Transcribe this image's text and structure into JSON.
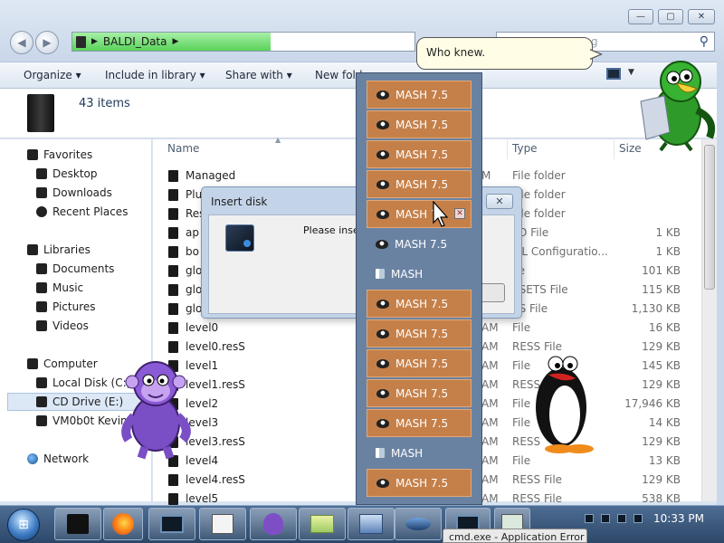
{
  "window": {
    "title_buttons": [
      "—",
      "▢",
      "✕"
    ],
    "address": {
      "folder": "BALDI_Data",
      "progress_percent": 58
    },
    "search_placeholder": "g",
    "toolbar": {
      "organize": "Organize ▾",
      "include": "Include in library ▾",
      "share": "Share with ▾",
      "new_folder": "New fold"
    },
    "item_count": "43 items"
  },
  "sidebar": {
    "favorites": "Favorites",
    "desktop": "Desktop",
    "downloads": "Downloads",
    "recent": "Recent Places",
    "libraries": "Libraries",
    "documents": "Documents",
    "music": "Music",
    "pictures": "Pictures",
    "videos": "Videos",
    "computer": "Computer",
    "local_disk": "Local Disk (C:)",
    "cd_drive": "CD Drive (E:)",
    "vm": "VM0b0t Kevin",
    "network": "Network"
  },
  "columns": {
    "name": "Name",
    "type": "Type",
    "size": "Size"
  },
  "files": [
    {
      "name": "Managed",
      "mod": "M",
      "type": "File folder",
      "size": ""
    },
    {
      "name": "Plu",
      "mod": "M",
      "type": "File folder",
      "size": ""
    },
    {
      "name": "Res",
      "mod": "M",
      "type": "File folder",
      "size": ""
    },
    {
      "name": "ap",
      "mod": "",
      "type": "FO File",
      "size": "1 KB"
    },
    {
      "name": "bo",
      "mod": "",
      "type": "ML Configuratio...",
      "size": "1 KB"
    },
    {
      "name": "glo",
      "mod": "",
      "type": "ile",
      "size": "101 KB"
    },
    {
      "name": "glo",
      "mod": "",
      "type": "SSETS File",
      "size": "115 KB"
    },
    {
      "name": "glo",
      "mod": "",
      "type": "SS File",
      "size": "1,130 KB"
    },
    {
      "name": "level0",
      "mod": "AM",
      "type": "File",
      "size": "16 KB"
    },
    {
      "name": "level0.resS",
      "mod": "AM",
      "type": "RESS File",
      "size": "129 KB"
    },
    {
      "name": "level1",
      "mod": "AM",
      "type": "File",
      "size": "145 KB"
    },
    {
      "name": "level1.resS",
      "mod": "AM",
      "type": "RESS",
      "size": "129 KB"
    },
    {
      "name": "level2",
      "mod": "AM",
      "type": "File",
      "size": "17,946 KB"
    },
    {
      "name": "level3",
      "mod": "AM",
      "type": "File",
      "size": "14 KB"
    },
    {
      "name": "level3.resS",
      "mod": "AM",
      "type": "RESS",
      "size": "129 KB"
    },
    {
      "name": "level4",
      "mod": "AM",
      "type": "File",
      "size": "13 KB"
    },
    {
      "name": "level4.resS",
      "mod": "AM",
      "type": "RESS File",
      "size": "129 KB"
    },
    {
      "name": "level5",
      "mod": "AM",
      "type": "RESS File",
      "size": "538 KB"
    }
  ],
  "dialog": {
    "title": "Insert disk",
    "message": "Please inser",
    "close": "✕"
  },
  "mash_menu": [
    {
      "label": "MASH 7.5",
      "style": "orange"
    },
    {
      "label": "MASH 7.5",
      "style": "orange"
    },
    {
      "label": "MASH 7.5",
      "style": "orange"
    },
    {
      "label": "MASH 7.5",
      "style": "orange"
    },
    {
      "label": "MASH 7.",
      "style": "orange",
      "close": "✕"
    },
    {
      "label": "MASH 7.5",
      "style": "plain"
    },
    {
      "label": "MASH",
      "style": "plain-doc"
    },
    {
      "label": "MASH 7.5",
      "style": "orange"
    },
    {
      "label": "MASH 7.5",
      "style": "orange"
    },
    {
      "label": "MASH 7.5",
      "style": "orange"
    },
    {
      "label": "MASH 7.5",
      "style": "orange"
    },
    {
      "label": "MASH 7.5",
      "style": "orange"
    },
    {
      "label": "MASH",
      "style": "plain-doc"
    },
    {
      "label": "MASH 7.5",
      "style": "orange"
    }
  ],
  "bubble": "Who knew.",
  "taskbar": {
    "clock": "10:33 PM",
    "cmd_tab": "cmd.exe - Application Error"
  },
  "colors": {
    "mash_orange": "#c5804a",
    "mash_menu_bg": "#6a82a2",
    "taskbar": "#3b5a80",
    "address_progress": "#5ad25a"
  }
}
